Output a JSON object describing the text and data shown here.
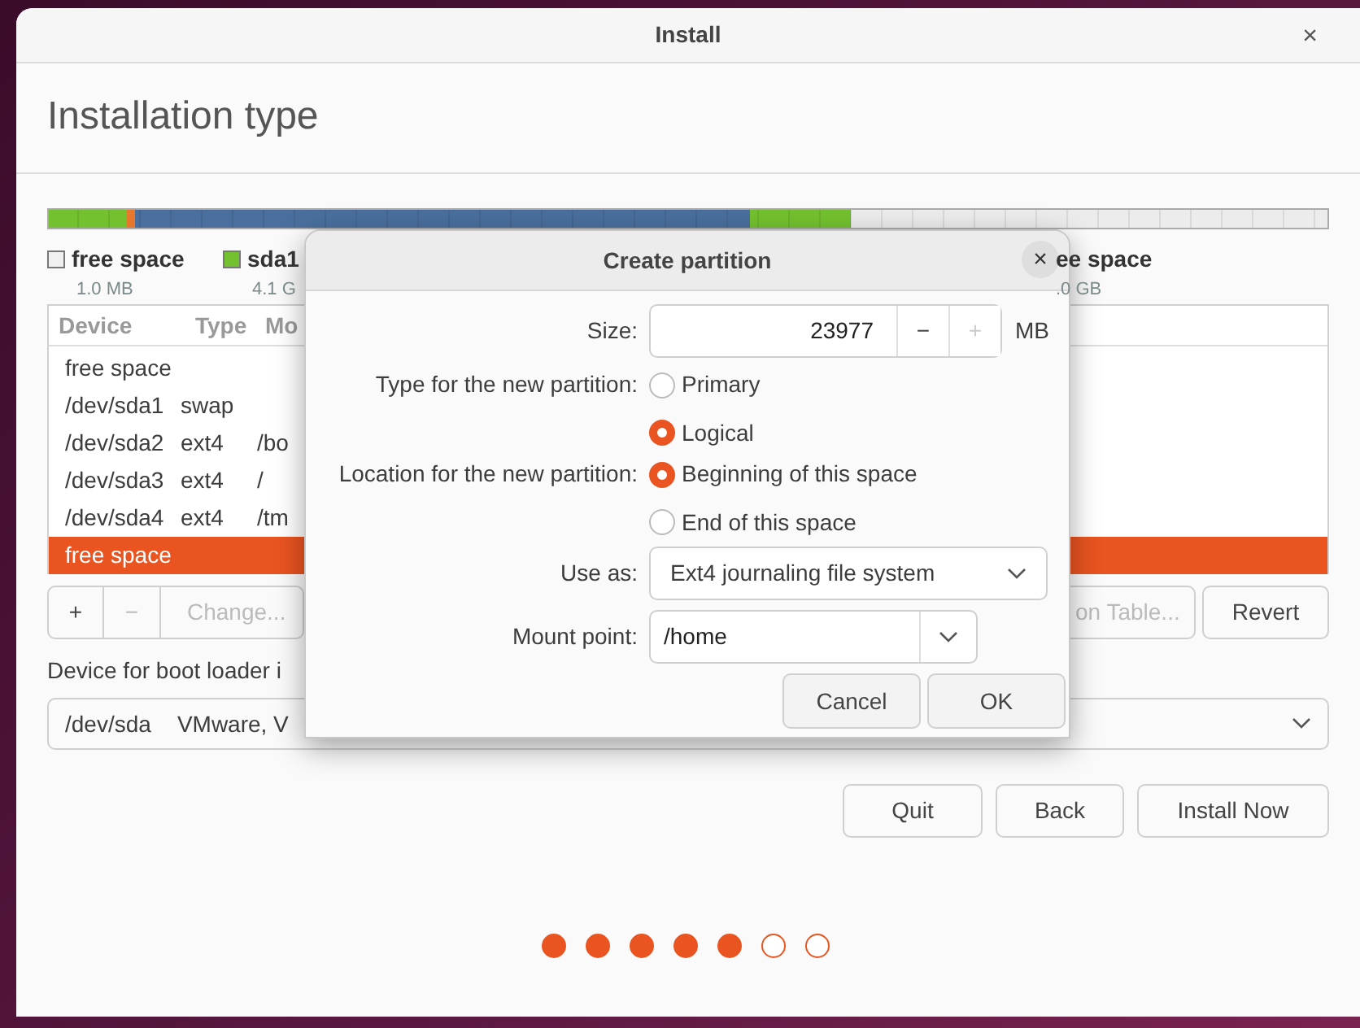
{
  "window": {
    "title": "Install",
    "close": "×"
  },
  "heading": "Installation type",
  "legend": [
    {
      "name": "free space",
      "size": "1.0 MB",
      "color": "#f0f0f0"
    },
    {
      "name": "sda1",
      "size": "4.1 G",
      "color": "#73c12f"
    },
    {
      "name": "ee space",
      "size": ".0 GB"
    }
  ],
  "table": {
    "columns": [
      "Device",
      "Type",
      "Mo"
    ],
    "rows": [
      {
        "cells": [
          "free space",
          "",
          ""
        ],
        "selected": false
      },
      {
        "cells": [
          "/dev/sda1",
          "swap",
          ""
        ],
        "selected": false
      },
      {
        "cells": [
          "/dev/sda2",
          "ext4",
          "/bo"
        ],
        "selected": false
      },
      {
        "cells": [
          "/dev/sda3",
          "ext4",
          "/"
        ],
        "selected": false
      },
      {
        "cells": [
          "/dev/sda4",
          "ext4",
          "/tm"
        ],
        "selected": false
      },
      {
        "cells": [
          "free space",
          "",
          ""
        ],
        "selected": true
      }
    ]
  },
  "toolbar": [
    {
      "label": "+",
      "disabled": false
    },
    {
      "label": "−",
      "disabled": true
    },
    {
      "label": "Change...",
      "disabled": true
    },
    {
      "label": "on Table...",
      "disabled": true
    },
    {
      "label": "Revert",
      "disabled": false
    }
  ],
  "boot_loader": {
    "label": "Device for boot loader i",
    "device": "/dev/sda",
    "model": "VMware, V"
  },
  "buttons": [
    "Quit",
    "Back",
    "Install Now"
  ],
  "steps": [
    {
      "done": true
    },
    {
      "done": true
    },
    {
      "done": true
    },
    {
      "done": true
    },
    {
      "done": true
    },
    {
      "done": false
    },
    {
      "done": false
    }
  ],
  "dialog": {
    "title": "Create partition",
    "close": "×",
    "size": {
      "label": "Size:",
      "value": "23977",
      "minus": {
        "label": "−",
        "disabled": false
      },
      "plus": {
        "label": "+",
        "disabled": true
      },
      "unit": "MB"
    },
    "type": {
      "label": "Type for the new partition:",
      "options": [
        {
          "label": "Primary",
          "selected": false
        },
        {
          "label": "Logical",
          "selected": true
        }
      ]
    },
    "location": {
      "label": "Location for the new partition:",
      "options": [
        {
          "label": "Beginning of this space",
          "selected": true
        },
        {
          "label": "End of this space",
          "selected": false
        }
      ]
    },
    "use_as": {
      "label": "Use as:",
      "value": "Ext4 journaling file system"
    },
    "mount": {
      "label": "Mount point:",
      "value": "/home"
    },
    "buttons": [
      "Cancel",
      "OK"
    ]
  }
}
